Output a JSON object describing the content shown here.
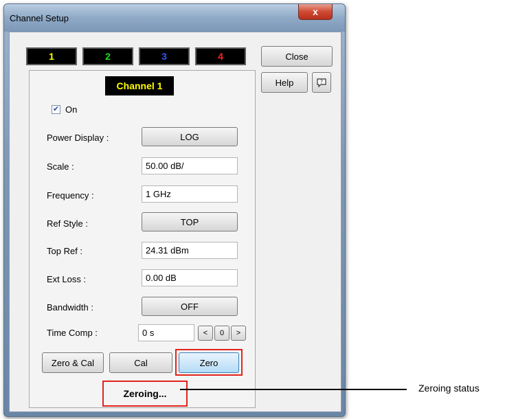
{
  "window": {
    "title": "Channel Setup",
    "close_glyph": "x"
  },
  "channel_tabs": [
    {
      "label": "1",
      "color": "#ffff00"
    },
    {
      "label": "2",
      "color": "#22dd22"
    },
    {
      "label": "3",
      "color": "#3355ff"
    },
    {
      "label": "4",
      "color": "#ff2222"
    }
  ],
  "side_buttons": {
    "close": "Close",
    "help": "Help",
    "context_help_icon": "question-bubble-icon"
  },
  "panel": {
    "channel_title": "Channel 1",
    "on_checkbox": {
      "label": "On",
      "checked": true
    },
    "rows": {
      "power_display": {
        "label": "Power Display :",
        "value": "LOG"
      },
      "scale": {
        "label": "Scale :",
        "value": "50.00 dB/"
      },
      "frequency": {
        "label": "Frequency :",
        "value": "1 GHz"
      },
      "ref_style": {
        "label": "Ref Style :",
        "value": "TOP"
      },
      "top_ref": {
        "label": "Top Ref :",
        "value": "24.31 dBm"
      },
      "ext_loss": {
        "label": "Ext Loss :",
        "value": "0.00 dB"
      },
      "bandwidth": {
        "label": "Bandwidth :",
        "value": "OFF"
      },
      "time_comp": {
        "label": "Time Comp :",
        "value": "0 s",
        "dec": "<",
        "step": "0",
        "inc": ">"
      }
    },
    "buttons": {
      "zero_cal": "Zero & Cal",
      "cal": "Cal",
      "zero": "Zero"
    },
    "status": "Zeroing..."
  },
  "annotation": {
    "label": "Zeroing status",
    "highlight_color": "#e2231a"
  }
}
